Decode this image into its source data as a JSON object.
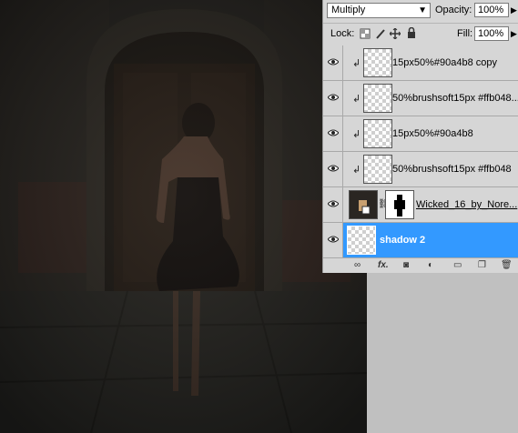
{
  "layers_panel": {
    "blend_mode": "Multiply",
    "opacity_label": "Opacity:",
    "opacity_value": "100%",
    "lock_label": "Lock:",
    "fill_label": "Fill:",
    "fill_value": "100%",
    "layers": [
      {
        "name": "15px50%#90a4b8 copy",
        "clipped": true,
        "selected": false
      },
      {
        "name": "50%brushsoft15px #ffb048...",
        "clipped": true,
        "selected": false
      },
      {
        "name": "15px50%#90a4b8",
        "clipped": true,
        "selected": false
      },
      {
        "name": "50%brushsoft15px #ffb048",
        "clipped": true,
        "selected": false
      },
      {
        "name": "Wicked_16_by_Nore...",
        "clipped": false,
        "selected": false
      },
      {
        "name": "shadow 2",
        "clipped": false,
        "selected": true
      }
    ],
    "bottom_icons": [
      "link-icon",
      "fx-icon",
      "mask-icon",
      "adjustment-icon",
      "folder-icon",
      "new-layer-icon",
      "trash-icon"
    ],
    "fx_label": "fx."
  },
  "colors": {
    "panel_bg": "#d6d6d6",
    "selection": "#3399ff",
    "canvas_dark": "#232220"
  }
}
